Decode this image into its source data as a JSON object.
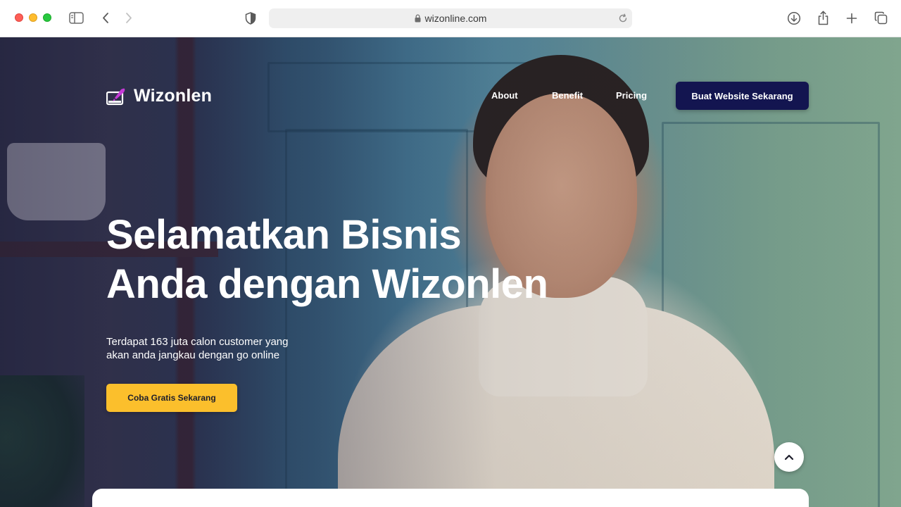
{
  "browser": {
    "url": "wizonline.com",
    "icons": [
      "sidebar-icon",
      "back-icon",
      "forward-icon",
      "privacy-shield-icon",
      "lock-icon",
      "reload-icon",
      "download-icon",
      "share-icon",
      "new-tab-icon",
      "tab-overview-icon"
    ]
  },
  "nav": {
    "brand": "Wizonlen",
    "links": [
      "About",
      "Benefit",
      "Pricing"
    ],
    "cta": "Buat Website Sekarang"
  },
  "hero": {
    "headline_lines": [
      "Selamatkan Bisnis",
      "Anda dengan Wizonlen"
    ],
    "subtext_lines": [
      "Terdapat 163 juta calon customer yang",
      "akan anda jangkau dengan go online"
    ],
    "cta": "Coba Gratis Sekarang"
  },
  "colors": {
    "nav_cta_bg": "#131550",
    "hero_cta_bg": "#fbbf2c",
    "logo_accent": "#c43bd6"
  }
}
